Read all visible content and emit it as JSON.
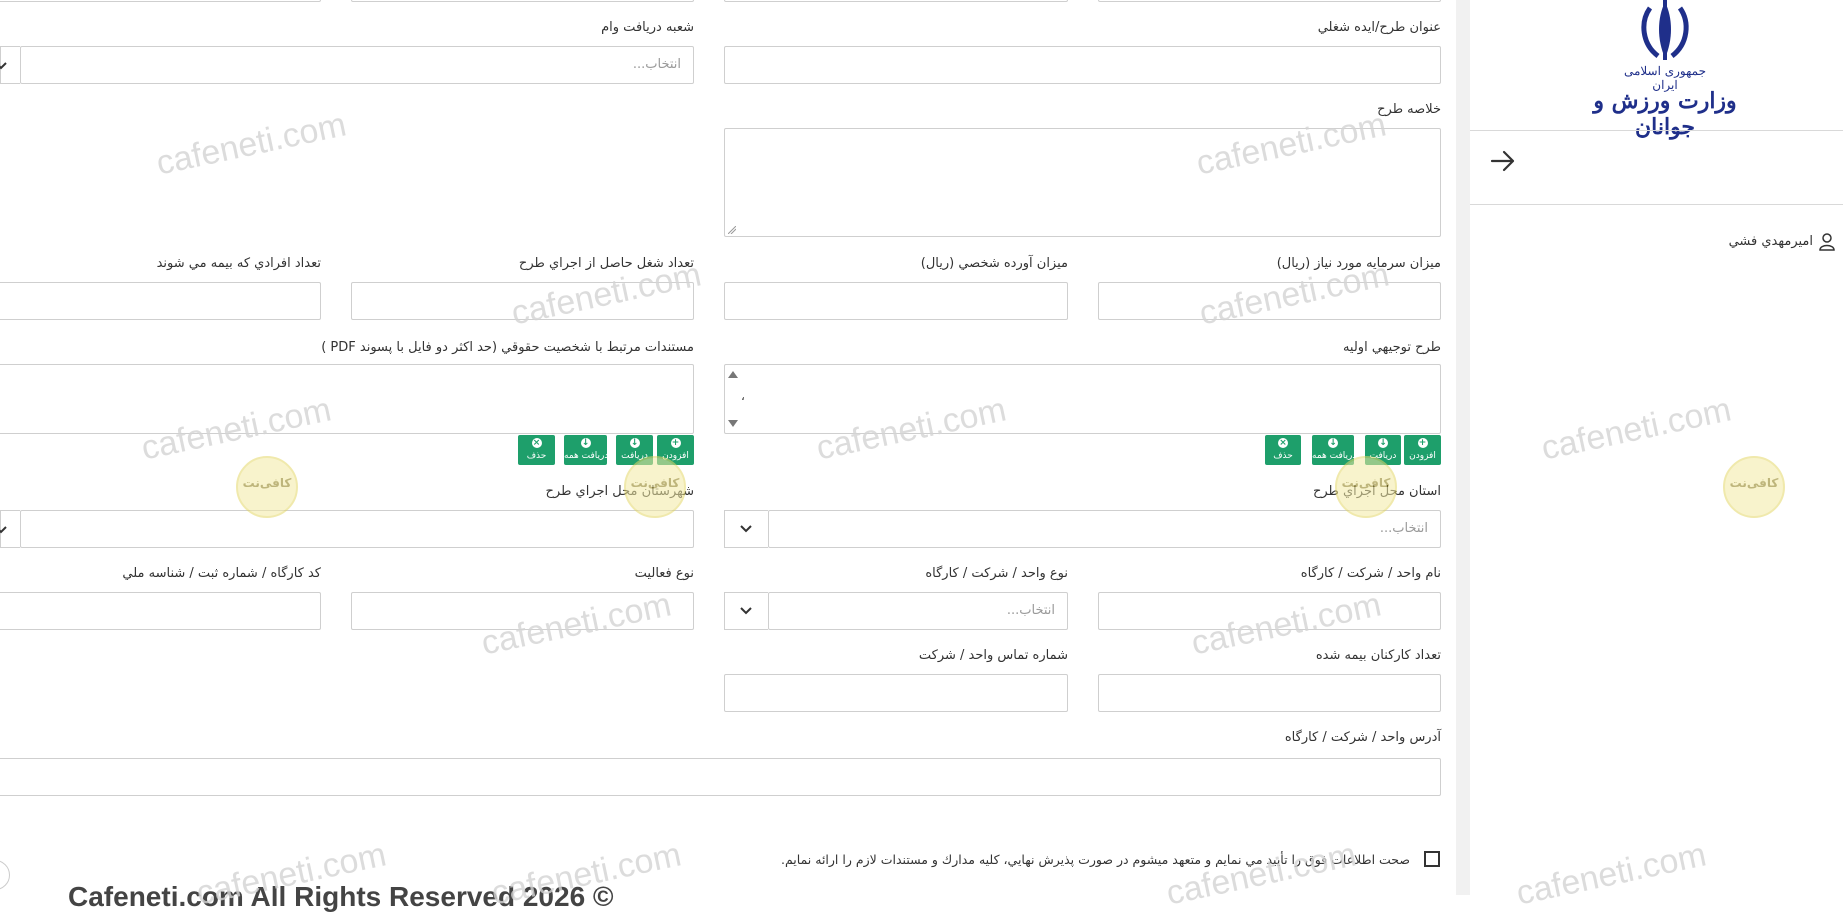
{
  "sidebar": {
    "logo_line1": "جمهوری اسلامی ایران",
    "logo_line2": "وزارت ورزش و جوانان",
    "user_name": "اميرمهدي فشي"
  },
  "form": {
    "title_label": "عنوان طرح/ايده شغلي",
    "branch_label": "شعبه دريافت وام",
    "branch_placeholder": "انتخاب...",
    "summary_label": "خلاصه طرح",
    "capital_label": "ميزان سرمايه مورد نياز (ريال)",
    "personal_label": "ميزان آورده شخصي (ريال)",
    "jobs_label": "تعداد شغل حاصل از اجراي طرح",
    "insured_people_label": "تعداد افرادي كه بيمه مي شوند",
    "feasibility_label": "طرح توجيهي اوليه",
    "feasibility_item": "،",
    "legal_docs_label": "مستندات مرتبط با شخصيت حقوقي (حد اكثر دو فايل با پسوند PDF )",
    "province_label": "استان محل اجراي طرح",
    "province_placeholder": "انتخاب...",
    "city_label": "شهرستان محل اجراي طرح",
    "unit_name_label": "نام واحد / شركت / كارگاه",
    "unit_type_label": "نوع واحد / شركت / كارگاه",
    "unit_type_placeholder": "انتخاب...",
    "activity_label": "نوع فعاليت",
    "workshop_code_label": "كد كارگاه / شماره ثبت / شناسه ملي",
    "insured_staff_label": "تعداد كاركنان بيمه شده",
    "phone_label": "شماره تماس واحد / شركت",
    "address_label": "آدرس واحد / شركت / كارگاه",
    "confirm_text": "صحت اطلاعات فوق را تأييد مي نمايم و متعهد ميشوم در صورت پذيرش نهايي، كليه مدارك و مستندات لازم را ارائه نمايم."
  },
  "file_buttons": {
    "add": "افزودن",
    "get": "دريافت",
    "get_all": "دريافت همه",
    "delete": "حذف"
  },
  "footer": {
    "copyright": "Cafeneti.com All Rights Reserved 2026 ©"
  },
  "watermark": {
    "text": "cafeneti.com",
    "seal_text": "کافی‌نت"
  },
  "colors": {
    "button_green": "#1e9f6b",
    "logo_blue": "#1f2f8a"
  },
  "icons": [
    "arrow-right-icon",
    "user-icon",
    "chevron-down-icon",
    "plus-circle-icon",
    "download-icon",
    "close-circle-icon",
    "emblem-icon"
  ]
}
